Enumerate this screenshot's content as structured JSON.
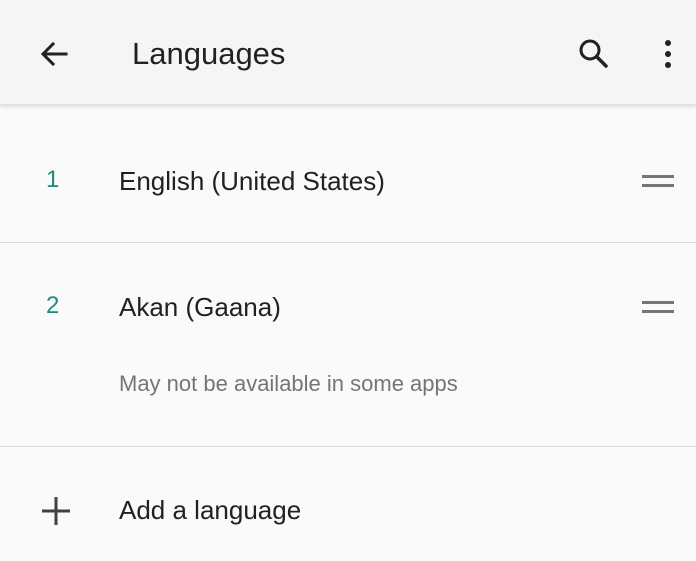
{
  "app_bar": {
    "title": "Languages",
    "icons": [
      "arrow-back-icon",
      "search-icon",
      "more-vert-icon"
    ]
  },
  "languages": [
    {
      "rank": "1",
      "name": "English (United States)",
      "note": ""
    },
    {
      "rank": "2",
      "name": "Akan (Gaana)",
      "note": "May not be available in some apps"
    }
  ],
  "add_language": {
    "label": "Add a language"
  },
  "colors": {
    "accent": "#218a7e",
    "text_primary": "#212121",
    "text_secondary": "#757575",
    "divider": "#dcdcdc"
  }
}
